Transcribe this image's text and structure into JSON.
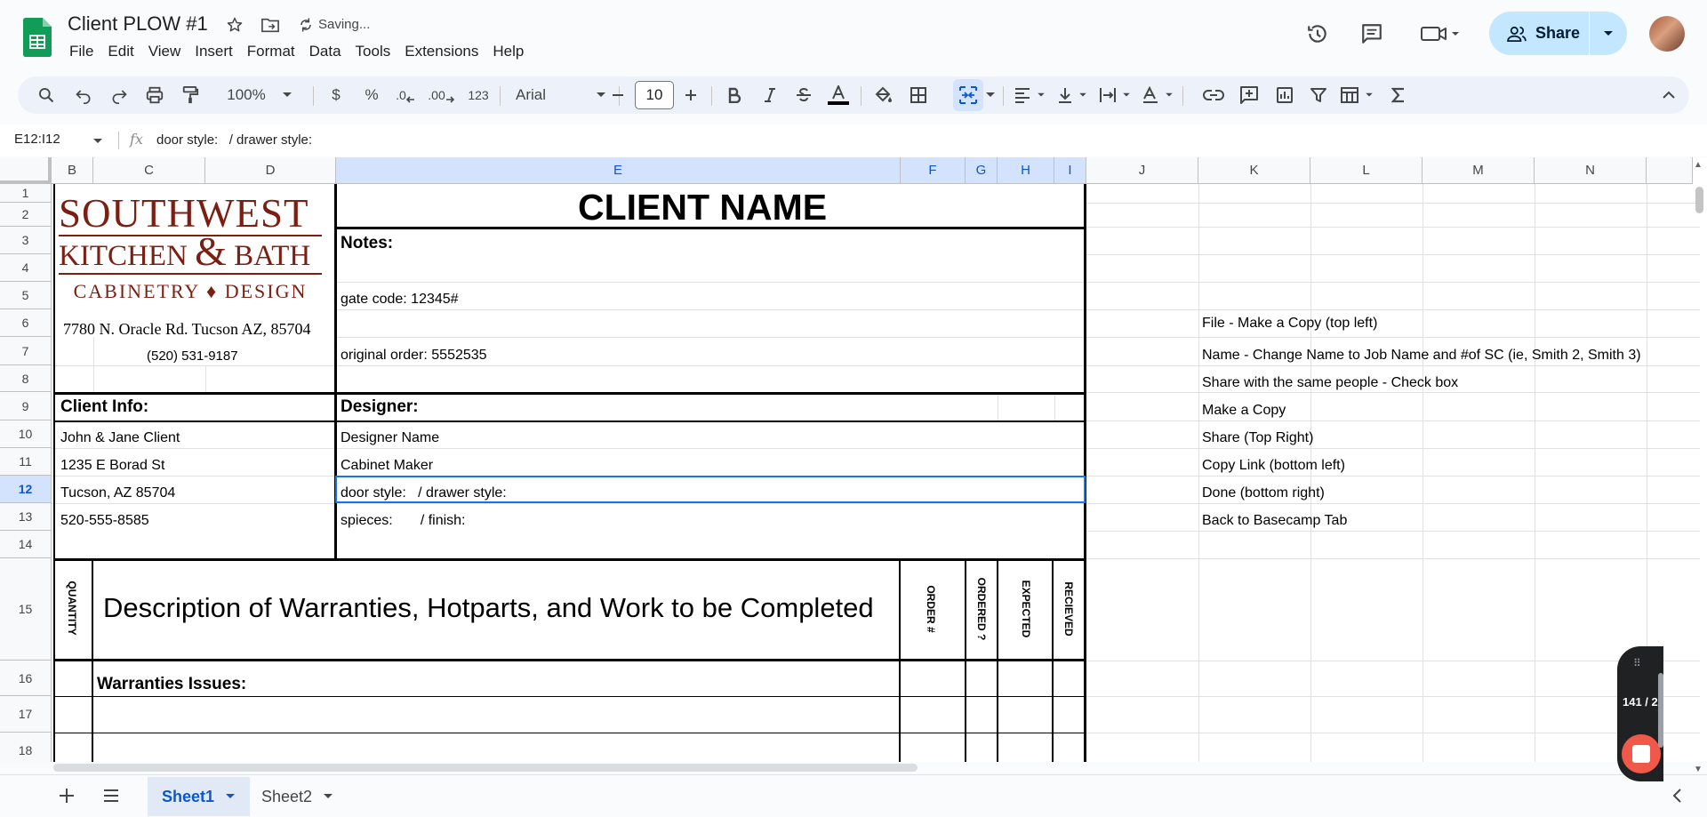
{
  "doc": {
    "title": "Client PLOW #1",
    "saving_status": "Saving..."
  },
  "menu": [
    "File",
    "Edit",
    "View",
    "Insert",
    "Format",
    "Data",
    "Tools",
    "Extensions",
    "Help"
  ],
  "share": {
    "label": "Share"
  },
  "toolbar": {
    "zoom": "100%",
    "currency": "$",
    "percent": "%",
    "decrease_decimal": ".0",
    "increase_decimal": ".00",
    "format_123": "123",
    "font": "Arial",
    "font_size": "10"
  },
  "formula_bar": {
    "name_box": "E12:I12",
    "fx": "fx",
    "content": "door style:   / drawer style:"
  },
  "columns": [
    "B",
    "C",
    "D",
    "E",
    "F",
    "G",
    "H",
    "I",
    "J",
    "K",
    "L",
    "M",
    "N"
  ],
  "rows": [
    "1",
    "2",
    "3",
    "4",
    "5",
    "6",
    "7",
    "8",
    "9",
    "10",
    "11",
    "12",
    "13",
    "14",
    "15",
    "16",
    "17",
    "18"
  ],
  "sheet": {
    "logo": {
      "line1": "SOUTHWEST",
      "line2a": "KITCHEN ",
      "line2amp": "&",
      "line2b": " BATH",
      "line3": "CABINETRY ♦ DESIGN"
    },
    "address": "7780 N. Oracle Rd. Tucson AZ, 85704",
    "phone": "(520) 531-9187",
    "client_name_heading": "CLIENT NAME",
    "notes_label": "Notes:",
    "gate_code": "gate code: 12345#",
    "original_order": "original order: 5552535",
    "client_info_label": "Client Info:",
    "designer_label": "Designer:",
    "client_lines": [
      "John & Jane Client",
      "1235 E Borad St",
      "Tucson, AZ 85704",
      "520-555-8585"
    ],
    "designer_lines": [
      "Designer Name",
      "Cabinet Maker",
      "door style:   / drawer style:",
      "spieces:       / finish:"
    ],
    "quantity_label": "QUANTITY",
    "description_heading": "Description of Warranties, Hotparts, and Work to be Completed",
    "order_no_label": "ORDER #",
    "ordered_label": "ORDERED ?",
    "expected_label": "EXPECTED",
    "recieved_label": "RECIEVED",
    "warranties_label": "Warranties Issues:",
    "instructions": [
      "File - Make a Copy (top left)",
      "Name - Change Name to Job Name and #of SC (ie, Smith 2, Smith 3)",
      "Share with the same people - Check box",
      "Make a Copy",
      "Share (Top Right)",
      "Copy Link (bottom left)",
      "Done (bottom right)",
      "Back to Basecamp Tab"
    ]
  },
  "tabs": [
    {
      "label": "Sheet1",
      "active": true
    },
    {
      "label": "Sheet2",
      "active": false
    }
  ],
  "recorder": {
    "count": "141 / 2"
  }
}
